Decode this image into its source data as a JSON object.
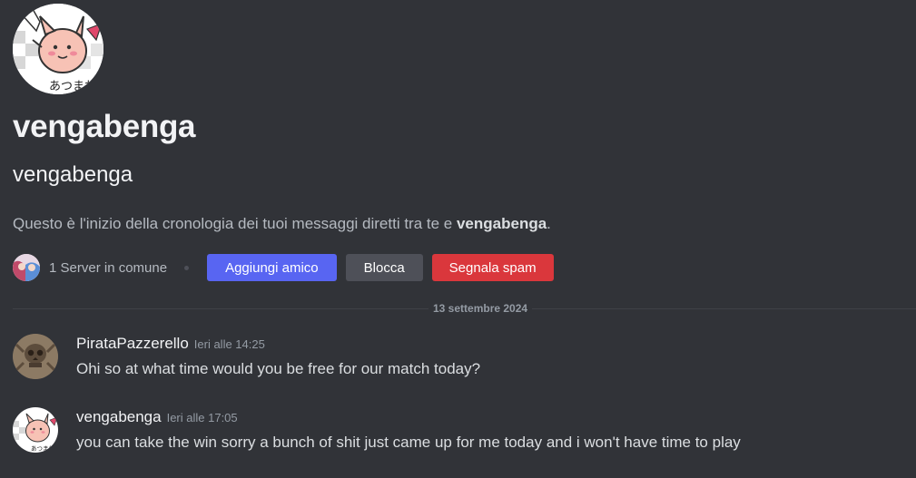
{
  "profile": {
    "display_name": "vengabenga",
    "username": "vengabenga",
    "intro_prefix": "Questo è l'inizio della cronologia dei tuoi messaggi diretti tra te e ",
    "intro_name": "vengabenga",
    "intro_suffix": ".",
    "avatar_icon": "kirby-clefairy-sticker-avatar"
  },
  "actions": {
    "mutual_servers": "1 Server in comune",
    "add_friend_label": "Aggiungi amico",
    "block_label": "Blocca",
    "report_spam_label": "Segnala spam"
  },
  "divider": {
    "date": "13 settembre 2024"
  },
  "messages": [
    {
      "author": "PirataPazzerello",
      "timestamp": "Ieri alle 14:25",
      "text": "Ohi so at what time would you be free for our match today?",
      "avatar_icon": "skull-avatar"
    },
    {
      "author": "vengabenga",
      "timestamp": "Ieri alle 17:05",
      "text": "you can take the win sorry a bunch of shit just came up for me today and i won't have time to play",
      "avatar_icon": "kirby-clefairy-sticker-avatar"
    }
  ],
  "colors": {
    "background": "#313338",
    "blurple": "#5865f2",
    "grey_button": "#4e5058",
    "danger": "#da373c"
  }
}
